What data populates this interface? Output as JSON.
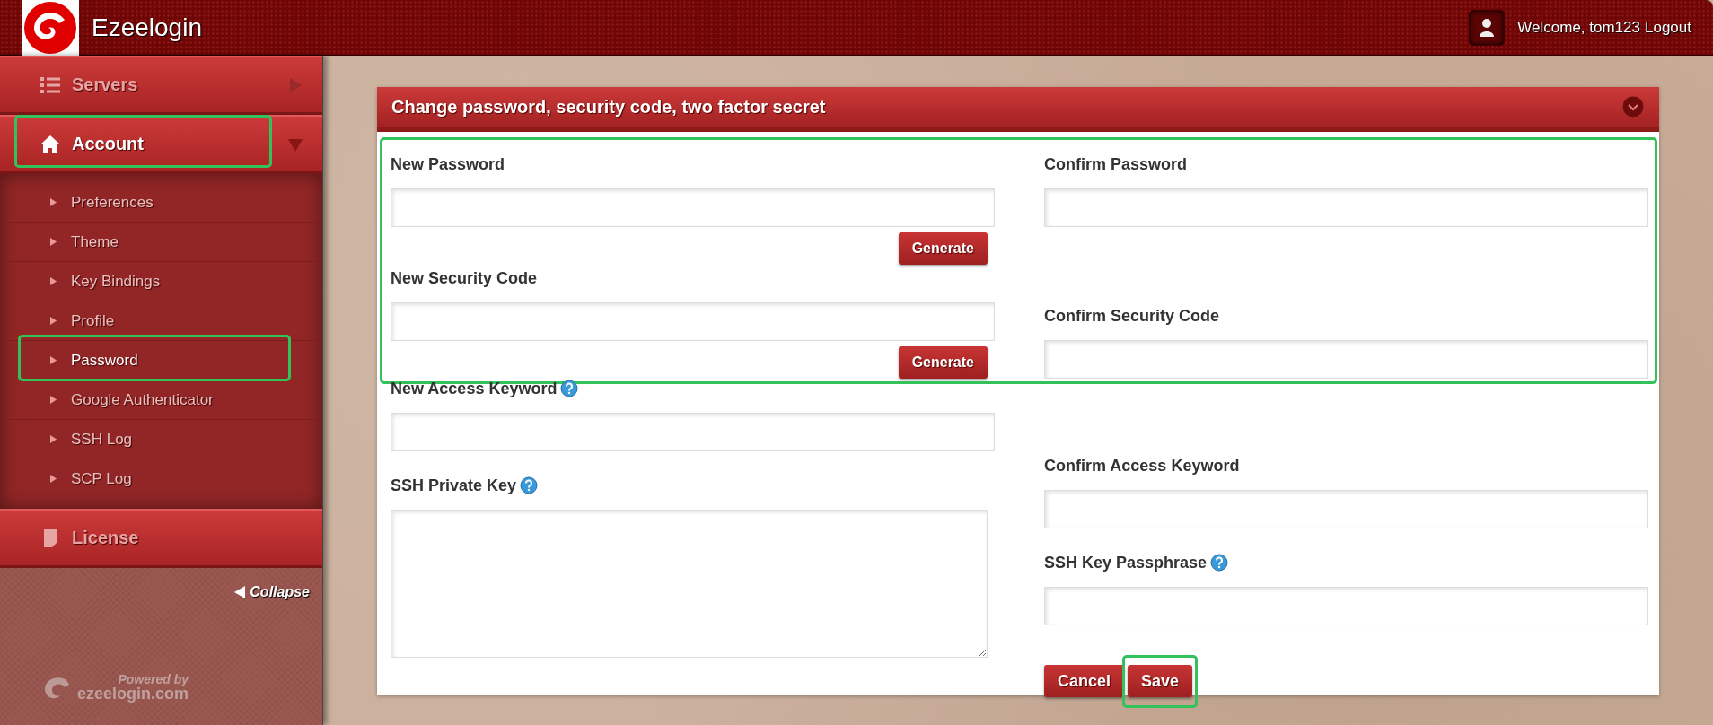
{
  "header": {
    "brand": "Ezeelogin",
    "welcome": "Welcome, tom123",
    "logout": "Logout"
  },
  "sidebar": {
    "sections": [
      {
        "label": "Servers",
        "selected": false,
        "expanded": false,
        "highlighted": false
      },
      {
        "label": "Account",
        "selected": true,
        "expanded": true,
        "highlighted": true,
        "children": [
          {
            "label": "Preferences",
            "selected": false,
            "highlighted": false
          },
          {
            "label": "Theme",
            "selected": false,
            "highlighted": false
          },
          {
            "label": "Key Bindings",
            "selected": false,
            "highlighted": false
          },
          {
            "label": "Profile",
            "selected": false,
            "highlighted": false
          },
          {
            "label": "Password",
            "selected": true,
            "highlighted": true
          },
          {
            "label": "Google Authenticator",
            "selected": false,
            "highlighted": false
          },
          {
            "label": "SSH Log",
            "selected": false,
            "highlighted": false
          },
          {
            "label": "SCP Log",
            "selected": false,
            "highlighted": false
          }
        ]
      },
      {
        "label": "License",
        "selected": false,
        "highlighted": false
      }
    ],
    "collapse": "Collapse",
    "powered_by": "Powered by",
    "powered_site": "ezeelogin.com"
  },
  "panel": {
    "title": "Change password, security code, two factor secret",
    "sections": [
      {
        "highlighted": true,
        "left": [
          {
            "label": "New Password",
            "kind": "input",
            "button": "Generate"
          },
          {
            "label": "New Security Code",
            "kind": "input",
            "button": "Generate"
          }
        ],
        "right": [
          {
            "label": "Confirm Password",
            "kind": "input"
          },
          {
            "label": "Confirm Security Code",
            "kind": "input"
          }
        ]
      },
      {
        "left": [
          {
            "label": "New Access Keyword",
            "kind": "input",
            "help": true
          },
          {
            "label": "SSH Private Key",
            "kind": "textarea",
            "help": true
          }
        ],
        "right": [
          {
            "label": "Confirm Access Keyword",
            "kind": "input"
          },
          {
            "label": "SSH Key Passphrase",
            "kind": "input",
            "help": true
          }
        ]
      }
    ],
    "buttons": [
      {
        "label": "Cancel"
      },
      {
        "label": "Save",
        "highlighted": true
      }
    ]
  }
}
